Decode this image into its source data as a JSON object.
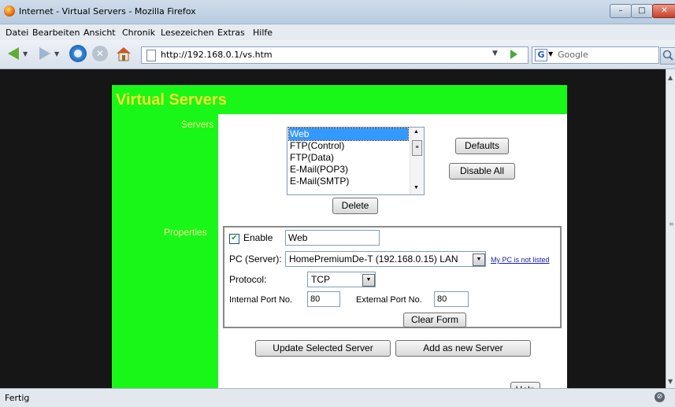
{
  "window": {
    "title": "Internet - Virtual Servers - Mozilla Firefox",
    "min_glyph": "–",
    "max_glyph": "□",
    "close_glyph": "✕"
  },
  "menu": {
    "items": [
      "Datei",
      "Bearbeiten",
      "Ansicht",
      "Chronik",
      "Lesezeichen",
      "Extras",
      "Hilfe"
    ]
  },
  "nav": {
    "url": "http://192.168.0.1/vs.htm",
    "search_engine": "Google",
    "stop_glyph": "✕",
    "dropdown_glyph": "▼"
  },
  "page": {
    "title": "Virtual Servers",
    "servers_label": "Servers",
    "properties_label": "Properties",
    "server_list": [
      "Web",
      "FTP(Control)",
      "FTP(Data)",
      "E-Mail(POP3)",
      "E-Mail(SMTP)"
    ],
    "selected_server": "Web",
    "buttons": {
      "defaults": "Defaults",
      "disable_all": "Disable All",
      "delete": "Delete",
      "clear_form": "Clear Form",
      "update": "Update Selected Server",
      "add_new": "Add as new Server",
      "help": "Help"
    },
    "form": {
      "enable_label": "Enable",
      "enable_checked": true,
      "name_value": "Web",
      "pc_label": "PC (Server):",
      "pc_value": "HomePremiumDe-T (192.168.0.15) LAN",
      "not_listed_link": "My PC is not listed",
      "protocol_label": "Protocol:",
      "protocol_value": "TCP",
      "internal_port_label": "Internal Port No.",
      "internal_port_value": "80",
      "external_port_label": "External Port No.",
      "external_port_value": "80"
    }
  },
  "status": {
    "text": "Fertig"
  },
  "colors": {
    "page_green": "#19f719",
    "title_yellow": "#f4e02f",
    "label_yellow": "#f4ee8c",
    "page_background": "#161616"
  },
  "icons": {
    "back": "back-arrow-icon",
    "forward": "forward-arrow-icon",
    "reload": "reload-icon",
    "stop": "stop-icon",
    "home": "home-icon",
    "search": "magnifier-icon"
  }
}
